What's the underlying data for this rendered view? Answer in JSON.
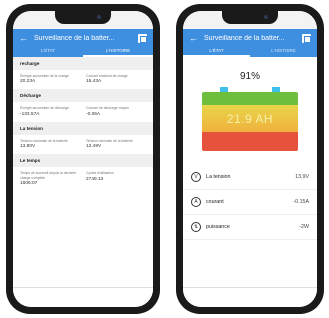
{
  "left": {
    "title": "Surveillance de la batter...",
    "tabs": [
      "L'ÉTAT",
      "L'HISTOIRE"
    ],
    "sections": [
      {
        "title": "recharge",
        "cells": [
          {
            "label": "Énergie accumulée de la charge",
            "value": "20.23A"
          },
          {
            "label": "Courant maximal de charge",
            "value": "15.43A"
          }
        ]
      },
      {
        "title": "Décharge",
        "cells": [
          {
            "label": "Énergie accumulée de décharge",
            "value": "-133.57A"
          },
          {
            "label": "Courant de décharge moyen",
            "value": "-0.06A"
          }
        ]
      },
      {
        "title": "La tension",
        "cells": [
          {
            "label": "Tension maximale de la batterie",
            "value": "13.80V"
          },
          {
            "label": "Tension minimale de la batterie",
            "value": "12.49V"
          }
        ]
      },
      {
        "title": "Le temps",
        "cells": [
          {
            "label": "Temps de sommeil depuis la dernière charge complète",
            "value": "1606:07"
          },
          {
            "label": "Cycles d'utilisation",
            "value": "2749.13"
          }
        ]
      }
    ]
  },
  "right": {
    "title": "Surveillance de la batter...",
    "tabs": [
      "L'ÉTAT",
      "L'HISTOIRE"
    ],
    "percent": "91%",
    "capacity": "21.9 AH",
    "level": 0.91,
    "metrics": [
      {
        "label": "La tension",
        "value": "13.9V"
      },
      {
        "label": "courant",
        "value": "-0.15A"
      },
      {
        "label": "puissance",
        "value": "-2W"
      }
    ]
  }
}
